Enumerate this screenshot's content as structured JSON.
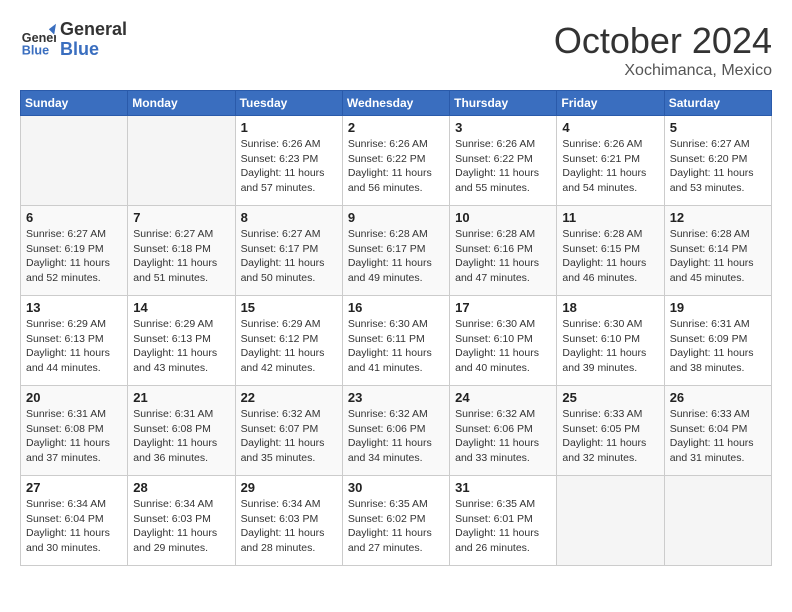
{
  "header": {
    "logo": {
      "line1": "General",
      "line2": "Blue"
    },
    "month": "October 2024",
    "location": "Xochimanca, Mexico"
  },
  "weekdays": [
    "Sunday",
    "Monday",
    "Tuesday",
    "Wednesday",
    "Thursday",
    "Friday",
    "Saturday"
  ],
  "weeks": [
    [
      {
        "day": "",
        "info": ""
      },
      {
        "day": "",
        "info": ""
      },
      {
        "day": "1",
        "info": "Sunrise: 6:26 AM\nSunset: 6:23 PM\nDaylight: 11 hours and 57 minutes."
      },
      {
        "day": "2",
        "info": "Sunrise: 6:26 AM\nSunset: 6:22 PM\nDaylight: 11 hours and 56 minutes."
      },
      {
        "day": "3",
        "info": "Sunrise: 6:26 AM\nSunset: 6:22 PM\nDaylight: 11 hours and 55 minutes."
      },
      {
        "day": "4",
        "info": "Sunrise: 6:26 AM\nSunset: 6:21 PM\nDaylight: 11 hours and 54 minutes."
      },
      {
        "day": "5",
        "info": "Sunrise: 6:27 AM\nSunset: 6:20 PM\nDaylight: 11 hours and 53 minutes."
      }
    ],
    [
      {
        "day": "6",
        "info": "Sunrise: 6:27 AM\nSunset: 6:19 PM\nDaylight: 11 hours and 52 minutes."
      },
      {
        "day": "7",
        "info": "Sunrise: 6:27 AM\nSunset: 6:18 PM\nDaylight: 11 hours and 51 minutes."
      },
      {
        "day": "8",
        "info": "Sunrise: 6:27 AM\nSunset: 6:17 PM\nDaylight: 11 hours and 50 minutes."
      },
      {
        "day": "9",
        "info": "Sunrise: 6:28 AM\nSunset: 6:17 PM\nDaylight: 11 hours and 49 minutes."
      },
      {
        "day": "10",
        "info": "Sunrise: 6:28 AM\nSunset: 6:16 PM\nDaylight: 11 hours and 47 minutes."
      },
      {
        "day": "11",
        "info": "Sunrise: 6:28 AM\nSunset: 6:15 PM\nDaylight: 11 hours and 46 minutes."
      },
      {
        "day": "12",
        "info": "Sunrise: 6:28 AM\nSunset: 6:14 PM\nDaylight: 11 hours and 45 minutes."
      }
    ],
    [
      {
        "day": "13",
        "info": "Sunrise: 6:29 AM\nSunset: 6:13 PM\nDaylight: 11 hours and 44 minutes."
      },
      {
        "day": "14",
        "info": "Sunrise: 6:29 AM\nSunset: 6:13 PM\nDaylight: 11 hours and 43 minutes."
      },
      {
        "day": "15",
        "info": "Sunrise: 6:29 AM\nSunset: 6:12 PM\nDaylight: 11 hours and 42 minutes."
      },
      {
        "day": "16",
        "info": "Sunrise: 6:30 AM\nSunset: 6:11 PM\nDaylight: 11 hours and 41 minutes."
      },
      {
        "day": "17",
        "info": "Sunrise: 6:30 AM\nSunset: 6:10 PM\nDaylight: 11 hours and 40 minutes."
      },
      {
        "day": "18",
        "info": "Sunrise: 6:30 AM\nSunset: 6:10 PM\nDaylight: 11 hours and 39 minutes."
      },
      {
        "day": "19",
        "info": "Sunrise: 6:31 AM\nSunset: 6:09 PM\nDaylight: 11 hours and 38 minutes."
      }
    ],
    [
      {
        "day": "20",
        "info": "Sunrise: 6:31 AM\nSunset: 6:08 PM\nDaylight: 11 hours and 37 minutes."
      },
      {
        "day": "21",
        "info": "Sunrise: 6:31 AM\nSunset: 6:08 PM\nDaylight: 11 hours and 36 minutes."
      },
      {
        "day": "22",
        "info": "Sunrise: 6:32 AM\nSunset: 6:07 PM\nDaylight: 11 hours and 35 minutes."
      },
      {
        "day": "23",
        "info": "Sunrise: 6:32 AM\nSunset: 6:06 PM\nDaylight: 11 hours and 34 minutes."
      },
      {
        "day": "24",
        "info": "Sunrise: 6:32 AM\nSunset: 6:06 PM\nDaylight: 11 hours and 33 minutes."
      },
      {
        "day": "25",
        "info": "Sunrise: 6:33 AM\nSunset: 6:05 PM\nDaylight: 11 hours and 32 minutes."
      },
      {
        "day": "26",
        "info": "Sunrise: 6:33 AM\nSunset: 6:04 PM\nDaylight: 11 hours and 31 minutes."
      }
    ],
    [
      {
        "day": "27",
        "info": "Sunrise: 6:34 AM\nSunset: 6:04 PM\nDaylight: 11 hours and 30 minutes."
      },
      {
        "day": "28",
        "info": "Sunrise: 6:34 AM\nSunset: 6:03 PM\nDaylight: 11 hours and 29 minutes."
      },
      {
        "day": "29",
        "info": "Sunrise: 6:34 AM\nSunset: 6:03 PM\nDaylight: 11 hours and 28 minutes."
      },
      {
        "day": "30",
        "info": "Sunrise: 6:35 AM\nSunset: 6:02 PM\nDaylight: 11 hours and 27 minutes."
      },
      {
        "day": "31",
        "info": "Sunrise: 6:35 AM\nSunset: 6:01 PM\nDaylight: 11 hours and 26 minutes."
      },
      {
        "day": "",
        "info": ""
      },
      {
        "day": "",
        "info": ""
      }
    ]
  ]
}
